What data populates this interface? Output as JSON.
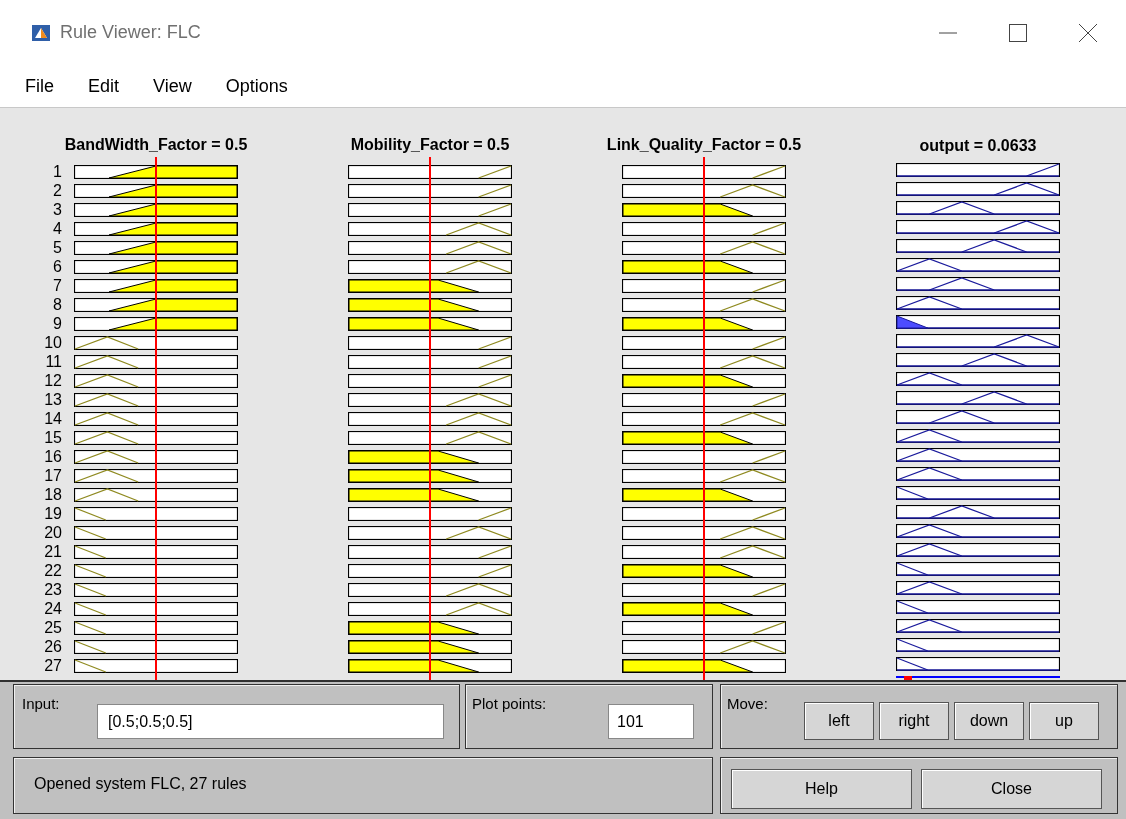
{
  "window": {
    "title": "Rule Viewer: FLC"
  },
  "menu": [
    "File",
    "Edit",
    "View",
    "Options"
  ],
  "columns": [
    {
      "title": "BandWidth_Factor = 0.5",
      "kind": "input"
    },
    {
      "title": "Mobility_Factor = 0.5",
      "kind": "input"
    },
    {
      "title": "Link_Quality_Factor = 0.5",
      "kind": "input"
    },
    {
      "title": "output = 0.0633",
      "kind": "output"
    }
  ],
  "rules": [
    {
      "number": "1",
      "cells": [
        {
          "kind": "high",
          "filled": true
        },
        {
          "kind": "high",
          "filled": false
        },
        {
          "kind": "high",
          "filled": false
        },
        {
          "kind": "max",
          "filled": false
        }
      ]
    },
    {
      "number": "2",
      "cells": [
        {
          "kind": "high",
          "filled": true
        },
        {
          "kind": "high",
          "filled": false
        },
        {
          "kind": "medium",
          "filled": false
        },
        {
          "kind": "high",
          "filled": false
        }
      ]
    },
    {
      "number": "3",
      "cells": [
        {
          "kind": "high",
          "filled": true
        },
        {
          "kind": "high",
          "filled": false
        },
        {
          "kind": "low",
          "filled": true
        },
        {
          "kind": "medlow",
          "filled": false
        }
      ]
    },
    {
      "number": "4",
      "cells": [
        {
          "kind": "high",
          "filled": true
        },
        {
          "kind": "medium",
          "filled": false
        },
        {
          "kind": "high",
          "filled": false
        },
        {
          "kind": "high",
          "filled": false
        }
      ]
    },
    {
      "number": "5",
      "cells": [
        {
          "kind": "high",
          "filled": true
        },
        {
          "kind": "medium",
          "filled": false
        },
        {
          "kind": "medium",
          "filled": false
        },
        {
          "kind": "medhigh",
          "filled": false
        }
      ]
    },
    {
      "number": "6",
      "cells": [
        {
          "kind": "high",
          "filled": true
        },
        {
          "kind": "medium",
          "filled": false
        },
        {
          "kind": "low",
          "filled": true
        },
        {
          "kind": "low",
          "filled": false
        }
      ]
    },
    {
      "number": "7",
      "cells": [
        {
          "kind": "high",
          "filled": true
        },
        {
          "kind": "low",
          "filled": true
        },
        {
          "kind": "high",
          "filled": false
        },
        {
          "kind": "medlow",
          "filled": false
        }
      ]
    },
    {
      "number": "8",
      "cells": [
        {
          "kind": "high",
          "filled": true
        },
        {
          "kind": "low",
          "filled": true
        },
        {
          "kind": "medium",
          "filled": false
        },
        {
          "kind": "low",
          "filled": false
        }
      ]
    },
    {
      "number": "9",
      "cells": [
        {
          "kind": "high",
          "filled": true
        },
        {
          "kind": "low",
          "filled": true
        },
        {
          "kind": "low",
          "filled": true
        },
        {
          "kind": "zero",
          "filled": true
        }
      ]
    },
    {
      "number": "10",
      "cells": [
        {
          "kind": "medium",
          "filled": false
        },
        {
          "kind": "high",
          "filled": false
        },
        {
          "kind": "high",
          "filled": false
        },
        {
          "kind": "high",
          "filled": false
        }
      ]
    },
    {
      "number": "11",
      "cells": [
        {
          "kind": "medium",
          "filled": false
        },
        {
          "kind": "high",
          "filled": false
        },
        {
          "kind": "medium",
          "filled": false
        },
        {
          "kind": "medhigh",
          "filled": false
        }
      ]
    },
    {
      "number": "12",
      "cells": [
        {
          "kind": "medium",
          "filled": false
        },
        {
          "kind": "high",
          "filled": false
        },
        {
          "kind": "low",
          "filled": true
        },
        {
          "kind": "low",
          "filled": false
        }
      ]
    },
    {
      "number": "13",
      "cells": [
        {
          "kind": "medium",
          "filled": false
        },
        {
          "kind": "medium",
          "filled": false
        },
        {
          "kind": "high",
          "filled": false
        },
        {
          "kind": "medhigh",
          "filled": false
        }
      ]
    },
    {
      "number": "14",
      "cells": [
        {
          "kind": "medium",
          "filled": false
        },
        {
          "kind": "medium",
          "filled": false
        },
        {
          "kind": "medium",
          "filled": false
        },
        {
          "kind": "medlow",
          "filled": false
        }
      ]
    },
    {
      "number": "15",
      "cells": [
        {
          "kind": "medium",
          "filled": false
        },
        {
          "kind": "medium",
          "filled": false
        },
        {
          "kind": "low",
          "filled": true
        },
        {
          "kind": "low",
          "filled": false
        }
      ]
    },
    {
      "number": "16",
      "cells": [
        {
          "kind": "medium",
          "filled": false
        },
        {
          "kind": "low",
          "filled": true
        },
        {
          "kind": "high",
          "filled": false
        },
        {
          "kind": "low",
          "filled": false
        }
      ]
    },
    {
      "number": "17",
      "cells": [
        {
          "kind": "medium",
          "filled": false
        },
        {
          "kind": "low",
          "filled": true
        },
        {
          "kind": "medium",
          "filled": false
        },
        {
          "kind": "low",
          "filled": false
        }
      ]
    },
    {
      "number": "18",
      "cells": [
        {
          "kind": "medium",
          "filled": false
        },
        {
          "kind": "low",
          "filled": true
        },
        {
          "kind": "low",
          "filled": true
        },
        {
          "kind": "zero",
          "filled": false
        }
      ]
    },
    {
      "number": "19",
      "cells": [
        {
          "kind": "low",
          "filled": false
        },
        {
          "kind": "high",
          "filled": false
        },
        {
          "kind": "high",
          "filled": false
        },
        {
          "kind": "medlow",
          "filled": false
        }
      ]
    },
    {
      "number": "20",
      "cells": [
        {
          "kind": "low",
          "filled": false
        },
        {
          "kind": "medium",
          "filled": false
        },
        {
          "kind": "medium",
          "filled": false
        },
        {
          "kind": "low",
          "filled": false
        }
      ]
    },
    {
      "number": "21",
      "cells": [
        {
          "kind": "low",
          "filled": false
        },
        {
          "kind": "high",
          "filled": false
        },
        {
          "kind": "medium",
          "filled": false
        },
        {
          "kind": "low",
          "filled": false
        }
      ]
    },
    {
      "number": "22",
      "cells": [
        {
          "kind": "low",
          "filled": false
        },
        {
          "kind": "high",
          "filled": false
        },
        {
          "kind": "low",
          "filled": true
        },
        {
          "kind": "zero",
          "filled": false
        }
      ]
    },
    {
      "number": "23",
      "cells": [
        {
          "kind": "low",
          "filled": false
        },
        {
          "kind": "medium",
          "filled": false
        },
        {
          "kind": "high",
          "filled": false
        },
        {
          "kind": "low",
          "filled": false
        }
      ]
    },
    {
      "number": "24",
      "cells": [
        {
          "kind": "low",
          "filled": false
        },
        {
          "kind": "medium",
          "filled": false
        },
        {
          "kind": "low",
          "filled": true
        },
        {
          "kind": "zero",
          "filled": false
        }
      ]
    },
    {
      "number": "25",
      "cells": [
        {
          "kind": "low",
          "filled": false
        },
        {
          "kind": "low",
          "filled": true
        },
        {
          "kind": "high",
          "filled": false
        },
        {
          "kind": "low",
          "filled": false
        }
      ]
    },
    {
      "number": "26",
      "cells": [
        {
          "kind": "low",
          "filled": false
        },
        {
          "kind": "low",
          "filled": true
        },
        {
          "kind": "medium",
          "filled": false
        },
        {
          "kind": "zero",
          "filled": false
        }
      ]
    },
    {
      "number": "27",
      "cells": [
        {
          "kind": "low",
          "filled": false
        },
        {
          "kind": "low",
          "filled": true
        },
        {
          "kind": "low",
          "filled": true
        },
        {
          "kind": "zero",
          "filled": false
        }
      ]
    }
  ],
  "input": {
    "label": "Input:",
    "value": "[0.5;0.5;0.5]"
  },
  "plot_points": {
    "label": "Plot points:",
    "value": "101"
  },
  "move": {
    "label": "Move:",
    "buttons": [
      "left",
      "right",
      "down",
      "up"
    ]
  },
  "status": "Opened system FLC, 27 rules",
  "buttons": [
    "Help",
    "Close"
  ]
}
